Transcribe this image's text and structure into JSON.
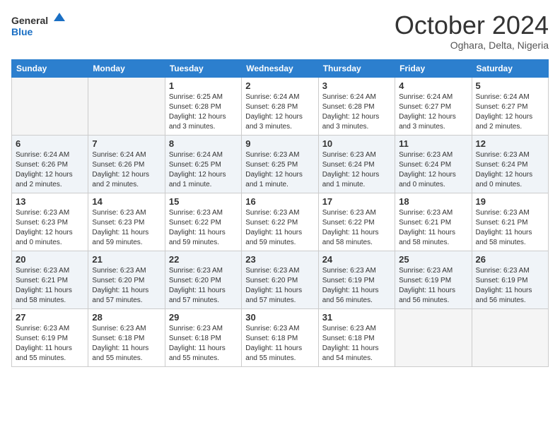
{
  "header": {
    "logo_line1": "General",
    "logo_line2": "Blue",
    "month": "October 2024",
    "location": "Oghara, Delta, Nigeria"
  },
  "weekdays": [
    "Sunday",
    "Monday",
    "Tuesday",
    "Wednesday",
    "Thursday",
    "Friday",
    "Saturday"
  ],
  "weeks": [
    [
      {
        "day": null
      },
      {
        "day": null
      },
      {
        "day": "1",
        "sunrise": "6:25 AM",
        "sunset": "6:28 PM",
        "daylight": "12 hours and 3 minutes."
      },
      {
        "day": "2",
        "sunrise": "6:24 AM",
        "sunset": "6:28 PM",
        "daylight": "12 hours and 3 minutes."
      },
      {
        "day": "3",
        "sunrise": "6:24 AM",
        "sunset": "6:28 PM",
        "daylight": "12 hours and 3 minutes."
      },
      {
        "day": "4",
        "sunrise": "6:24 AM",
        "sunset": "6:27 PM",
        "daylight": "12 hours and 3 minutes."
      },
      {
        "day": "5",
        "sunrise": "6:24 AM",
        "sunset": "6:27 PM",
        "daylight": "12 hours and 2 minutes."
      }
    ],
    [
      {
        "day": "6",
        "sunrise": "6:24 AM",
        "sunset": "6:26 PM",
        "daylight": "12 hours and 2 minutes."
      },
      {
        "day": "7",
        "sunrise": "6:24 AM",
        "sunset": "6:26 PM",
        "daylight": "12 hours and 2 minutes."
      },
      {
        "day": "8",
        "sunrise": "6:24 AM",
        "sunset": "6:25 PM",
        "daylight": "12 hours and 1 minute."
      },
      {
        "day": "9",
        "sunrise": "6:23 AM",
        "sunset": "6:25 PM",
        "daylight": "12 hours and 1 minute."
      },
      {
        "day": "10",
        "sunrise": "6:23 AM",
        "sunset": "6:24 PM",
        "daylight": "12 hours and 1 minute."
      },
      {
        "day": "11",
        "sunrise": "6:23 AM",
        "sunset": "6:24 PM",
        "daylight": "12 hours and 0 minutes."
      },
      {
        "day": "12",
        "sunrise": "6:23 AM",
        "sunset": "6:24 PM",
        "daylight": "12 hours and 0 minutes."
      }
    ],
    [
      {
        "day": "13",
        "sunrise": "6:23 AM",
        "sunset": "6:23 PM",
        "daylight": "12 hours and 0 minutes."
      },
      {
        "day": "14",
        "sunrise": "6:23 AM",
        "sunset": "6:23 PM",
        "daylight": "11 hours and 59 minutes."
      },
      {
        "day": "15",
        "sunrise": "6:23 AM",
        "sunset": "6:22 PM",
        "daylight": "11 hours and 59 minutes."
      },
      {
        "day": "16",
        "sunrise": "6:23 AM",
        "sunset": "6:22 PM",
        "daylight": "11 hours and 59 minutes."
      },
      {
        "day": "17",
        "sunrise": "6:23 AM",
        "sunset": "6:22 PM",
        "daylight": "11 hours and 58 minutes."
      },
      {
        "day": "18",
        "sunrise": "6:23 AM",
        "sunset": "6:21 PM",
        "daylight": "11 hours and 58 minutes."
      },
      {
        "day": "19",
        "sunrise": "6:23 AM",
        "sunset": "6:21 PM",
        "daylight": "11 hours and 58 minutes."
      }
    ],
    [
      {
        "day": "20",
        "sunrise": "6:23 AM",
        "sunset": "6:21 PM",
        "daylight": "11 hours and 58 minutes."
      },
      {
        "day": "21",
        "sunrise": "6:23 AM",
        "sunset": "6:20 PM",
        "daylight": "11 hours and 57 minutes."
      },
      {
        "day": "22",
        "sunrise": "6:23 AM",
        "sunset": "6:20 PM",
        "daylight": "11 hours and 57 minutes."
      },
      {
        "day": "23",
        "sunrise": "6:23 AM",
        "sunset": "6:20 PM",
        "daylight": "11 hours and 57 minutes."
      },
      {
        "day": "24",
        "sunrise": "6:23 AM",
        "sunset": "6:19 PM",
        "daylight": "11 hours and 56 minutes."
      },
      {
        "day": "25",
        "sunrise": "6:23 AM",
        "sunset": "6:19 PM",
        "daylight": "11 hours and 56 minutes."
      },
      {
        "day": "26",
        "sunrise": "6:23 AM",
        "sunset": "6:19 PM",
        "daylight": "11 hours and 56 minutes."
      }
    ],
    [
      {
        "day": "27",
        "sunrise": "6:23 AM",
        "sunset": "6:19 PM",
        "daylight": "11 hours and 55 minutes."
      },
      {
        "day": "28",
        "sunrise": "6:23 AM",
        "sunset": "6:18 PM",
        "daylight": "11 hours and 55 minutes."
      },
      {
        "day": "29",
        "sunrise": "6:23 AM",
        "sunset": "6:18 PM",
        "daylight": "11 hours and 55 minutes."
      },
      {
        "day": "30",
        "sunrise": "6:23 AM",
        "sunset": "6:18 PM",
        "daylight": "11 hours and 55 minutes."
      },
      {
        "day": "31",
        "sunrise": "6:23 AM",
        "sunset": "6:18 PM",
        "daylight": "11 hours and 54 minutes."
      },
      {
        "day": null
      },
      {
        "day": null
      }
    ]
  ],
  "labels": {
    "sunrise": "Sunrise:",
    "sunset": "Sunset:",
    "daylight": "Daylight:"
  }
}
